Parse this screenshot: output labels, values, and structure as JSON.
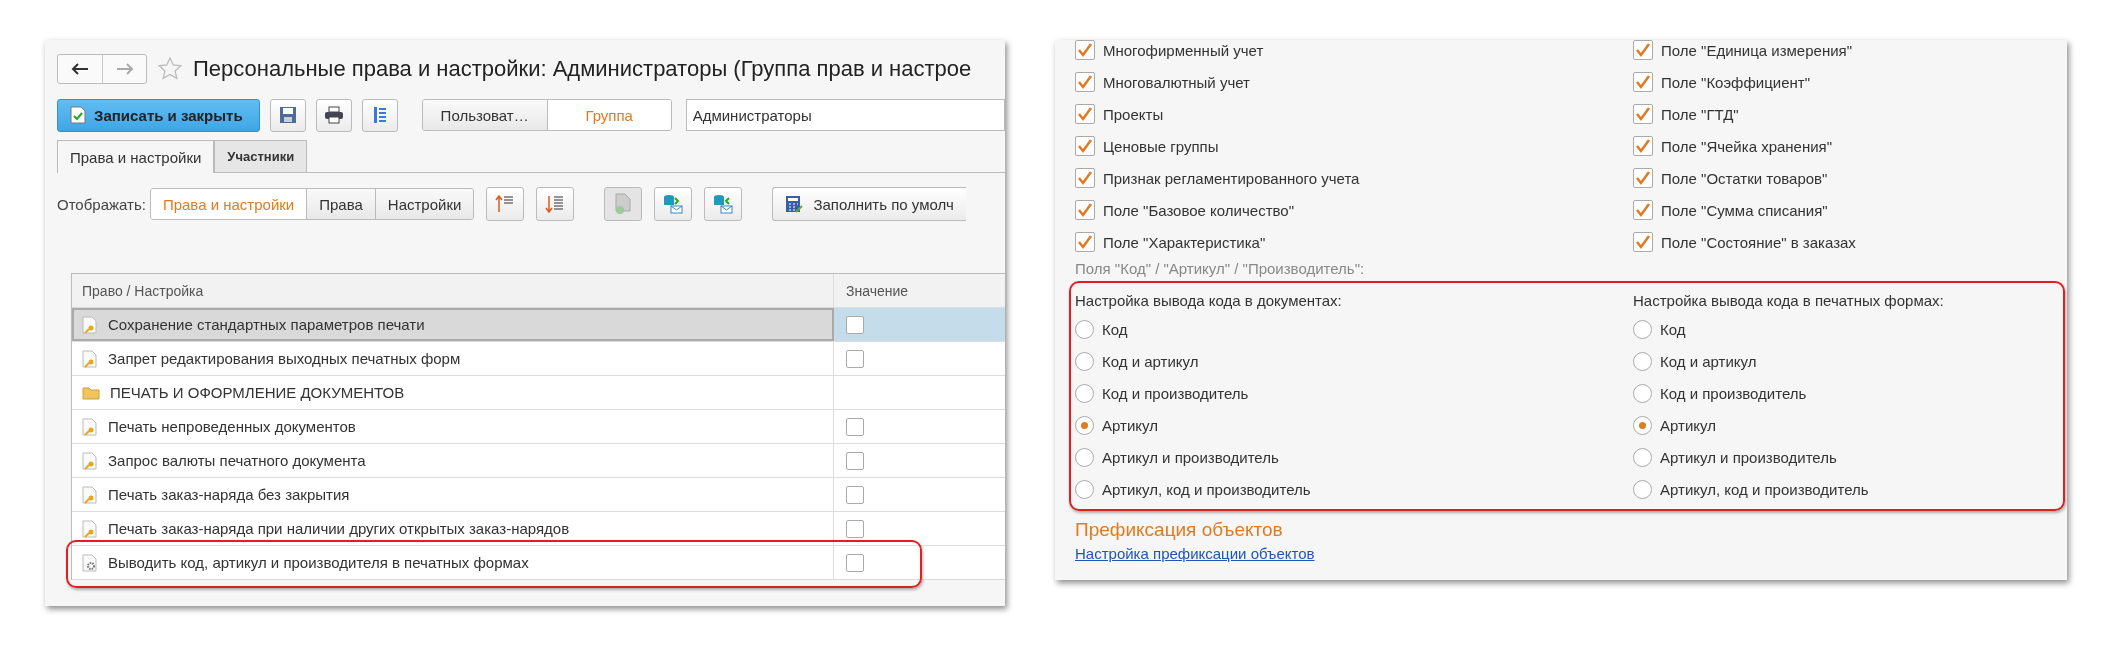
{
  "left_window": {
    "title": "Персональные права и настройки: Администраторы (Группа прав и настрое",
    "save_close_button": "Записать и закрыть",
    "owner_switch": [
      {
        "label": "Пользоват…",
        "selected": false
      },
      {
        "label": "Группа",
        "selected": true
      }
    ],
    "owner_field": {
      "value": "Администраторы"
    },
    "tabs": [
      {
        "label": "Права и настройки",
        "selected": true
      },
      {
        "label": "Участники",
        "selected": false
      }
    ],
    "display": {
      "label": "Отображать:",
      "options": [
        {
          "label": "Права и настройки",
          "selected": true
        },
        {
          "label": "Права",
          "selected": false
        },
        {
          "label": "Настройки",
          "selected": false
        }
      ]
    },
    "fill_default_button": "Заполнить по умолч",
    "table": {
      "columns": [
        "Право / Настройка",
        "Значение"
      ],
      "rows": [
        {
          "kind": "right",
          "label": "Сохранение стандартных параметров печати",
          "checked": false,
          "selected": true
        },
        {
          "kind": "right",
          "label": "Запрет редактирования выходных печатных форм",
          "checked": false,
          "selected": false
        },
        {
          "kind": "folder",
          "label": "ПЕЧАТЬ И ОФОРМЛЕНИЕ ДОКУМЕНТОВ",
          "selected": false
        },
        {
          "kind": "right",
          "label": "Печать непроведенных документов",
          "checked": false,
          "selected": false
        },
        {
          "kind": "right",
          "label": "Запрос валюты печатного документа",
          "checked": false,
          "selected": false
        },
        {
          "kind": "right",
          "label": "Печать заказ-наряда без закрытия",
          "checked": false,
          "selected": false
        },
        {
          "kind": "right",
          "label": "Печать заказ-наряда при наличии других открытых заказ-нарядов",
          "checked": false,
          "selected": false
        },
        {
          "kind": "setting",
          "label": "Выводить код, артикул и производителя в печатных формах",
          "checked": false,
          "selected": false
        }
      ]
    }
  },
  "right_window": {
    "checkboxes": [
      [
        {
          "label": "Многофирменный учет",
          "checked": true
        },
        {
          "label": "Многовалютный учет",
          "checked": true
        },
        {
          "label": "Проекты",
          "checked": true
        },
        {
          "label": "Ценовые группы",
          "checked": true
        },
        {
          "label": "Признак регламентированного учета",
          "checked": true
        },
        {
          "label": "Поле \"Базовое количество\"",
          "checked": true
        },
        {
          "label": "Поле \"Характеристика\"",
          "checked": true
        }
      ],
      [
        {
          "label": "Поле \"Единица измерения\"",
          "checked": true
        },
        {
          "label": "Поле \"Коэффициент\"",
          "checked": true
        },
        {
          "label": "Поле \"ГТД\"",
          "checked": true
        },
        {
          "label": "Поле \"Ячейка хранения\"",
          "checked": true
        },
        {
          "label": "Поле \"Остатки товаров\"",
          "checked": true
        },
        {
          "label": "Поле \"Сумма списания\"",
          "checked": true
        },
        {
          "label": "Поле \"Состояние\" в заказах",
          "checked": true
        }
      ]
    ],
    "fields_caption": "Поля \"Код\" / \"Артикул\" / \"Производитель\":",
    "radio_groups": [
      {
        "title": "Настройка вывода кода в документах:",
        "options": [
          {
            "label": "Код",
            "selected": false
          },
          {
            "label": "Код и артикул",
            "selected": false
          },
          {
            "label": "Код и производитель",
            "selected": false
          },
          {
            "label": "Артикул",
            "selected": true
          },
          {
            "label": "Артикул и производитель",
            "selected": false
          },
          {
            "label": "Артикул, код и производитель",
            "selected": false
          }
        ]
      },
      {
        "title": "Настройка вывода кода в печатных формах:",
        "options": [
          {
            "label": "Код",
            "selected": false
          },
          {
            "label": "Код и артикул",
            "selected": false
          },
          {
            "label": "Код и производитель",
            "selected": false
          },
          {
            "label": "Артикул",
            "selected": true
          },
          {
            "label": "Артикул и производитель",
            "selected": false
          },
          {
            "label": "Артикул, код и производитель",
            "selected": false
          }
        ]
      }
    ],
    "prefix_heading": "Префиксация объектов",
    "prefix_link": "Настройка префиксации объектов"
  }
}
